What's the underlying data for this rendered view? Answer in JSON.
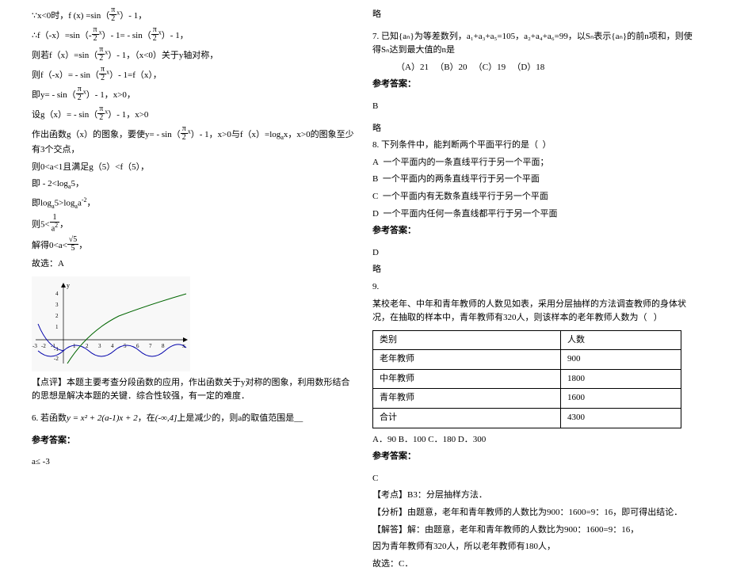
{
  "left": {
    "l1a": "∵x<0时，f (x) =sin（",
    "l1b": "）- 1，",
    "pi": "π",
    "two": "2",
    "x": "x",
    "l2a": "∴f（-x）=sin（-",
    "l2b": "）- 1= - sin（",
    "l2c": "）- 1，",
    "l3a": "则若f（x）=sin（",
    "l3b": "）- 1，（x<0）关于y轴对称，",
    "l4a": "则f（-x）= - sin（",
    "l4b": "）- 1=f（x），",
    "l5a": "即y= - sin（",
    "l5b": "）- 1，x>0，",
    "l6a": "设g（x）= - sin（",
    "l6b": "）- 1，x>0",
    "l7a": "作出函数g（x）的图象，要使y= - sin（",
    "l7b": "）- 1，x>0与f（x）=log",
    "l7c": "x，x>0的图象至少有3个交点，",
    "l8": "则0<a<1且满足g（5）<f（5），",
    "l9": "即 - 2<log",
    "l9b": "5，",
    "l10a": "即log",
    "l10b": "5>",
    "l10c": "log",
    "l10d": "a",
    "l10e": "-2",
    "l10f": "，",
    "l11a": "则5<",
    "l11b": "1",
    "l11c": "a",
    "l11d": "2",
    "l11e": "，",
    "l12a": "解得0<a<",
    "l12b": "√5",
    "l12c": "5",
    "l12d": "，",
    "l13": "故选：A",
    "comment": "【点评】本题主要考查分段函数的应用，作出函数关于y对称的图象，利用数形结合的思想是解决本题的关键．综合性较强，有一定的难度．",
    "q6a": "6. 若函数",
    "q6b": "y = x² + 2(a-1)x + 2",
    "q6c": "，在",
    "q6d": "(-∞,4]",
    "q6e": "上是减少的，则a的取值范围是__",
    "refAns": "参考答案：",
    "l14": "a≤ -3",
    "graphLabels": {
      "y": "y",
      "x": "x",
      "v4": "4",
      "v3": "3",
      "v2": "2",
      "v1": "1",
      "vm1": "-1",
      "vm2": "-2",
      "vm3": "-3",
      "h1": "1",
      "h2": "2",
      "h3": "3",
      "h4": "4",
      "h5": "5",
      "h6": "6",
      "h7": "7",
      "h8": "8",
      "hm1": "-1",
      "hm2": "-2",
      "hm3": "-3"
    }
  },
  "right": {
    "略": "略",
    "q7a": "7. 已知",
    "q7b": "{aₙ}",
    "q7c": "为等差数列，",
    "q7d": "a₁+a₃+a₅=105，a₂+a₄+a₆=99，以",
    "q7e": "Sₙ",
    "q7f": "表示",
    "q7g": "{aₙ}",
    "q7h": "的前n项和，则使得",
    "q7i": "Sₙ",
    "q7j": "达到最大值的n是",
    "q7opts": "（A）21   （B）20   （C）19   （D）18",
    "refAns": "参考答案：",
    "ans7": "B",
    "q8": "8. 下列条件中，能判断两个平面平行的是（  ）",
    "q8a": "A  一个平面内的一条直线平行于另一个平面；",
    "q8b": "B  一个平面内的两条直线平行于另一个平面",
    "q8c": "C  一个平面内有无数条直线平行于另一个平面",
    "q8d": "D  一个平面内任何一条直线都平行于另一个平面",
    "ans8": "D",
    "q9": "9.",
    "q9text": "某校老年、中年和青年教师的人数见如表，采用分层抽样的方法调查教师的身体状况，在抽取的样本中，青年教师有320人，则该样本的老年教师人数为（   ）",
    "th1": "类别",
    "th2": "人数",
    "r1a": "老年教师",
    "r1b": "900",
    "r2a": "中年教师",
    "r2b": "1800",
    "r3a": "青年教师",
    "r3b": "1600",
    "r4a": "合计",
    "r4b": "4300",
    "q9opts": "A．90 B．100 C．180 D．300",
    "ans9": "C",
    "kd": "【考点】B3：分层抽样方法．",
    "fx": "【分析】由题意，老年和青年教师的人数比为900：1600=9：16，即可得出结论．",
    "jd1": "【解答】解：由题意，老年和青年教师的人数比为900：1600=9：16，",
    "jd2": "因为青年教师有320人，所以老年教师有180人，",
    "jd3": "故选：C．"
  }
}
